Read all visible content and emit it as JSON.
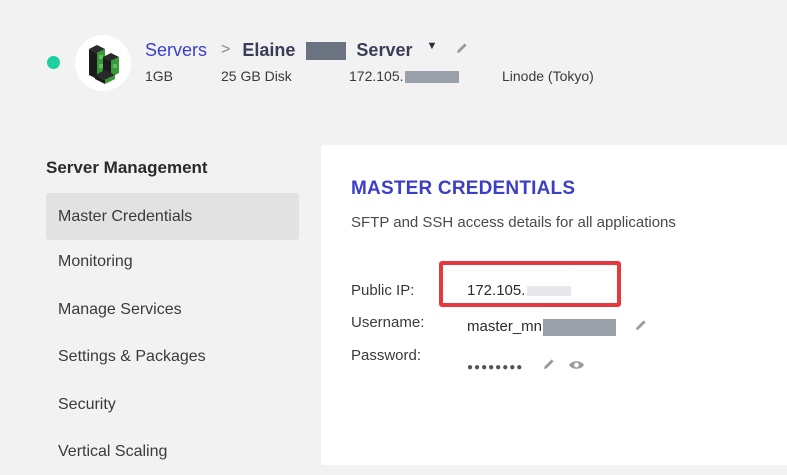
{
  "header": {
    "status_color": "#1bd1a0",
    "logo_icon": "linode-logo-icon",
    "breadcrumb_servers": "Servers",
    "breadcrumb_separator": ">",
    "server_name_first": "Elaine",
    "server_name_last": "Server",
    "dropdown_icon": "caret-down-icon",
    "edit_icon": "pencil-icon",
    "ram": "1GB",
    "disk": "25 GB Disk",
    "ip_prefix": "172.105.",
    "provider": "Linode (Tokyo)"
  },
  "sidebar": {
    "title": "Server Management",
    "items": [
      {
        "label": "Master Credentials",
        "active": true
      },
      {
        "label": "Monitoring",
        "active": false
      },
      {
        "label": "Manage Services",
        "active": false
      },
      {
        "label": "Settings & Packages",
        "active": false
      },
      {
        "label": "Security",
        "active": false
      },
      {
        "label": "Vertical Scaling",
        "active": false
      }
    ]
  },
  "credentials": {
    "title": "MASTER CREDENTIALS",
    "subtitle": "SFTP and SSH access details for all applications",
    "public_ip_label": "Public IP:",
    "public_ip_value": "172.105.",
    "username_label": "Username:",
    "username_value": "master_mn",
    "password_label": "Password:",
    "password_value": "●●●●●●●●",
    "highlight_color": "#e8383e",
    "accent": "#3c3fc6"
  }
}
